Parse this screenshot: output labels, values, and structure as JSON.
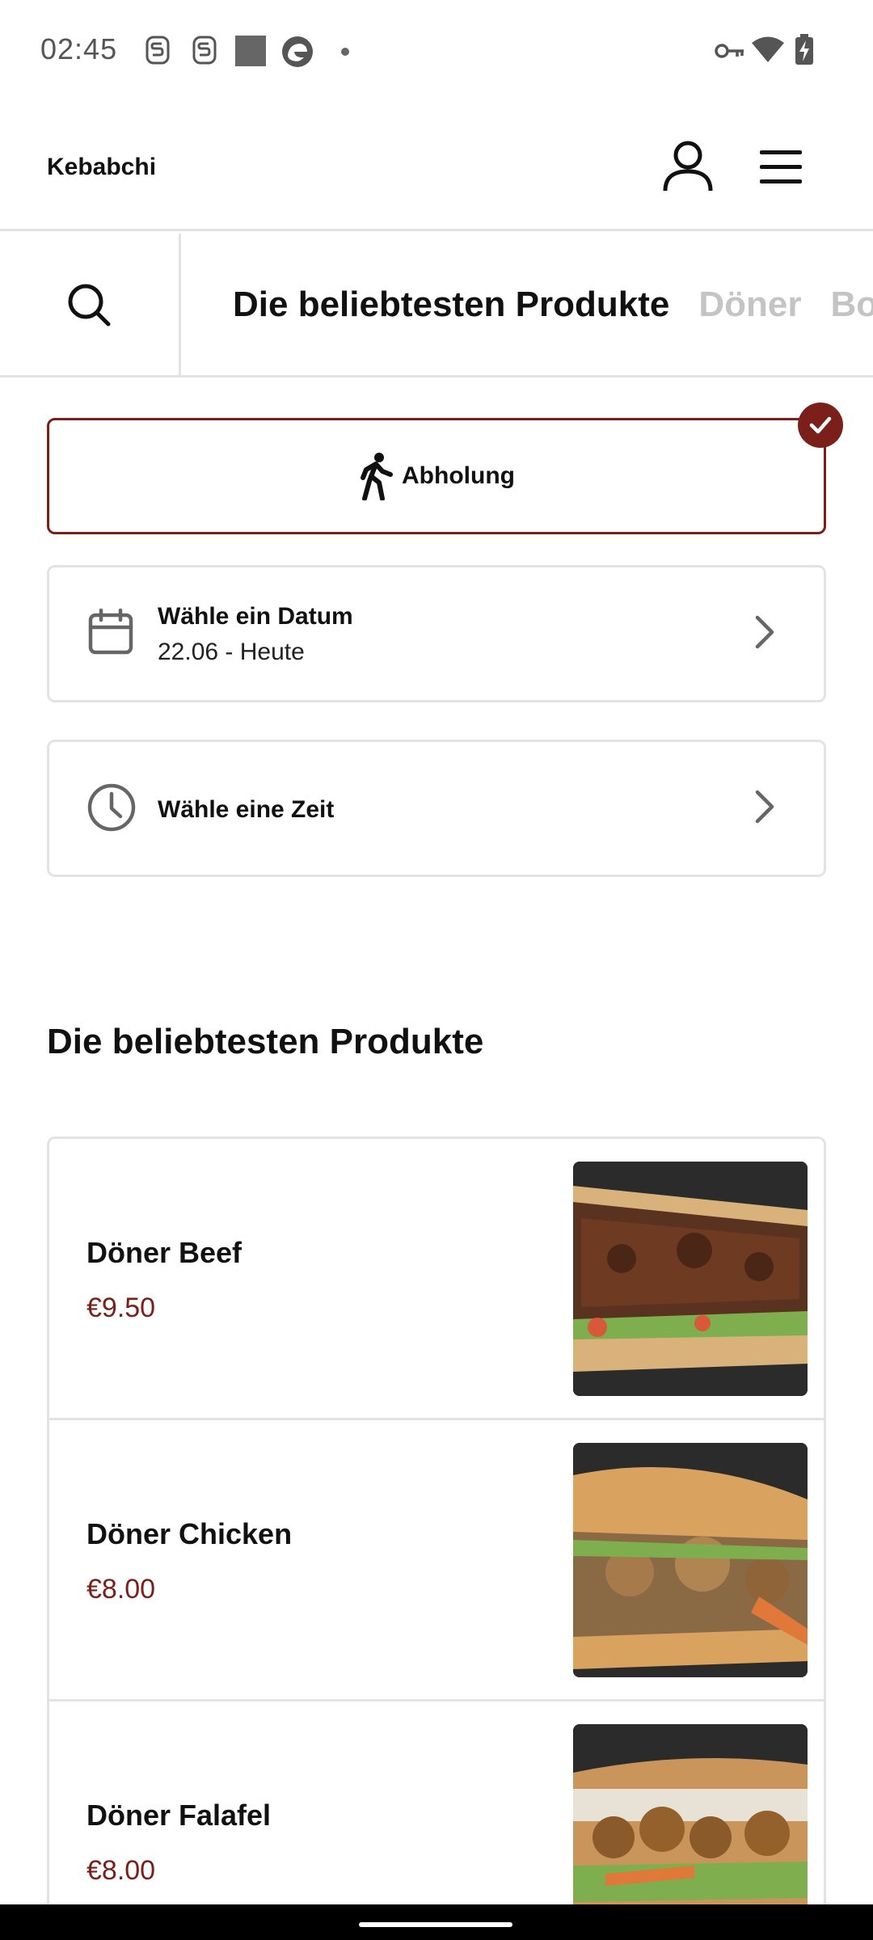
{
  "status_bar": {
    "time": "02:45",
    "left_icons": [
      "s-notification-icon",
      "s-notification-icon",
      "square-app-icon",
      "edge-browser-icon",
      "dot-icon"
    ],
    "right_icons": [
      "key-icon",
      "wifi-icon",
      "battery-charging-icon"
    ]
  },
  "header": {
    "brand": "Kebabchi",
    "user_icon": "user-icon",
    "menu_icon": "hamburger-menu-icon"
  },
  "category_bar": {
    "search_icon": "search-icon",
    "tabs": [
      {
        "label": "Die beliebtesten Produkte",
        "active": true
      },
      {
        "label": "Döner",
        "active": false
      },
      {
        "label": "Bo",
        "active": false
      }
    ]
  },
  "order_options": {
    "pickup_label": "Abholung",
    "pickup_selected": true,
    "date": {
      "title": "Wähle ein Datum",
      "value": "22.06 - Heute"
    },
    "time": {
      "title": "Wähle eine Zeit"
    }
  },
  "section": {
    "title": "Die beliebtesten Produkte"
  },
  "products": [
    {
      "name": "Döner Beef",
      "price": "€9.50"
    },
    {
      "name": "Döner Chicken",
      "price": "€8.00"
    },
    {
      "name": "Döner Falafel",
      "price": "€8.00"
    }
  ],
  "colors": {
    "accent": "#7a1f1a",
    "border": "#e3e3e3",
    "inactive_tab": "#c4c4c4"
  }
}
